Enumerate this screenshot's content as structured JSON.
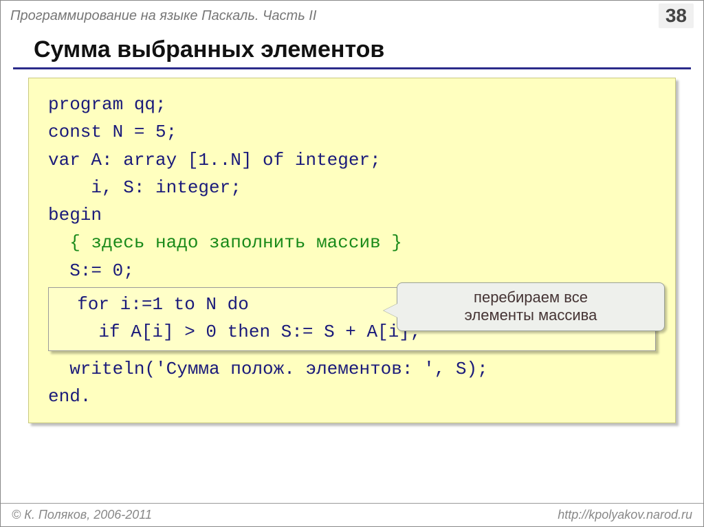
{
  "header": {
    "breadcrumb": "Программирование на языке Паскаль. Часть II",
    "page_number": "38"
  },
  "title": "Сумма выбранных элементов",
  "code": {
    "l1": "program qq;",
    "l2": "const N = 5;",
    "l3": "var A: array [1..N] of integer;",
    "l4": "    i, S: integer;",
    "l5": "begin",
    "l6": "  { здесь надо заполнить массив }",
    "l7": "  S:= 0;",
    "l8": "  for i:=1 to N do",
    "l9": "    if A[i] > 0 then S:= S + A[i];",
    "l10": "  writeln('Сумма полож. элементов: ', S);",
    "l11": "end."
  },
  "callout": {
    "line1": "перебираем все",
    "line2": "элементы массива"
  },
  "footer": {
    "author": "© К. Поляков, 2006-2011",
    "url": "http://kpolyakov.narod.ru"
  }
}
